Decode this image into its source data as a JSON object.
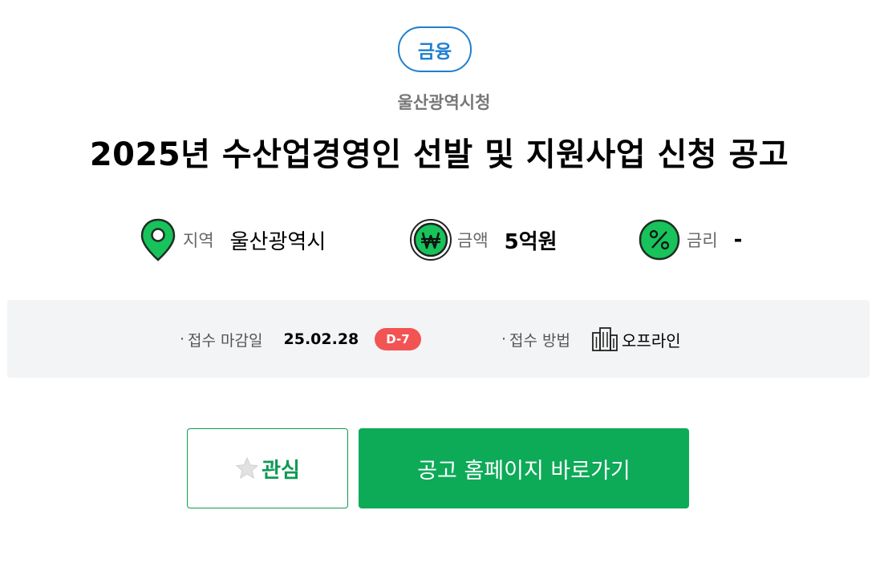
{
  "category": "금융",
  "agency": "울산광역시청",
  "title": "2025년 수산업경영인 선발 및 지원사업 신청 공고",
  "info": {
    "region": {
      "icon": "map-pin-icon",
      "label": "지역",
      "value": "울산광역시"
    },
    "amount": {
      "icon": "won-icon",
      "label": "금액",
      "value": "5억원"
    },
    "rate": {
      "icon": "percent-icon",
      "label": "금리",
      "value": "-"
    }
  },
  "deadline": {
    "bullet": "·",
    "label": "접수 마감일",
    "date": "25.02.28",
    "dday": "D-7"
  },
  "method": {
    "label": "접수 방법",
    "icon": "building-icon",
    "value": "오프라인"
  },
  "buttons": {
    "favorite_label": "관심",
    "favorite_icon": "star-icon",
    "homepage_label": "공고 홈페이지 바로가기"
  },
  "colors": {
    "accent_green": "#0daa58",
    "badge_blue": "#1f7fd0",
    "dday_red": "#f25454",
    "icon_green": "#17c35a"
  }
}
